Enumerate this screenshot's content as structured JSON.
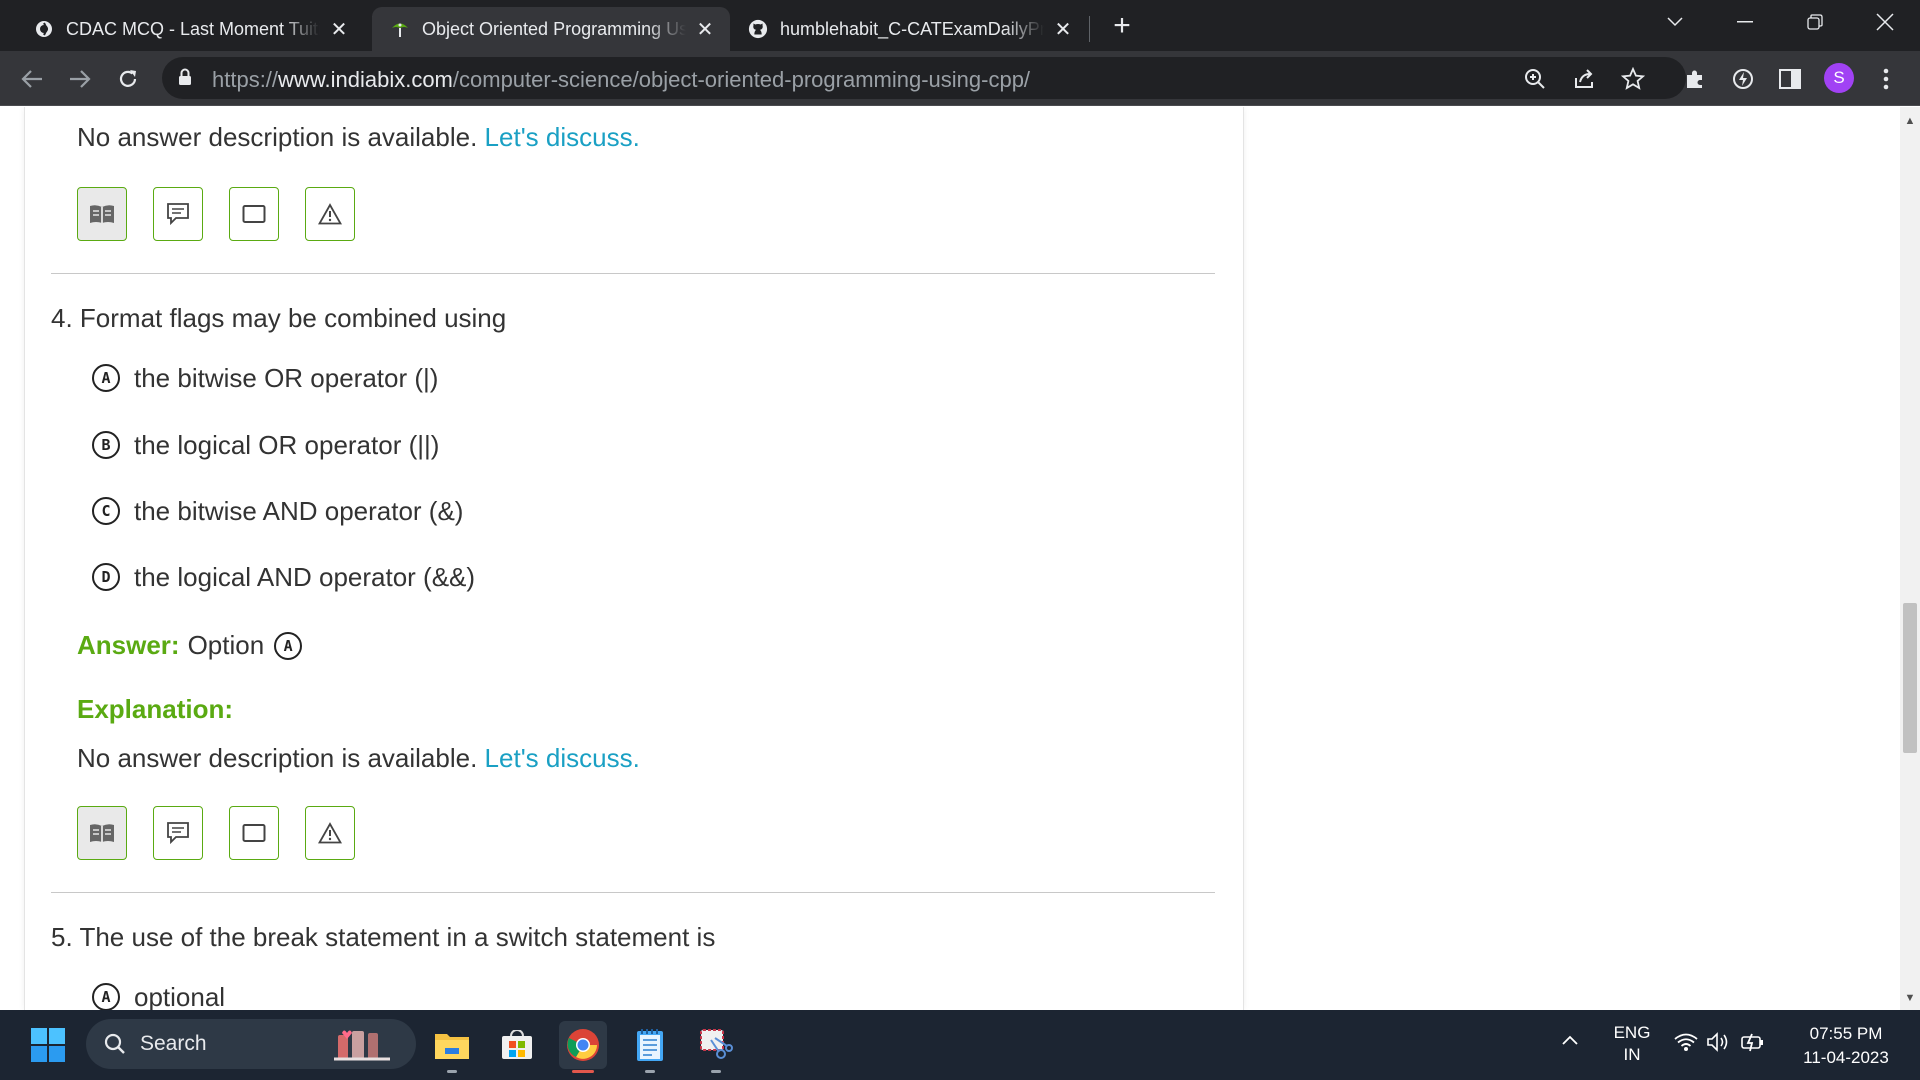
{
  "browser": {
    "tabs": [
      {
        "title": "CDAC MCQ - Last Moment Tuitio",
        "favicon": "cdac-favicon-icon",
        "active": false
      },
      {
        "title": "Object Oriented Programming Us",
        "favicon": "indiabix-favicon-icon",
        "active": true
      },
      {
        "title": "humblehabit_C-CATExamDailyPra",
        "favicon": "github-favicon-icon",
        "active": false
      }
    ],
    "url": {
      "scheme": "https://",
      "host": "www.indiabix.com",
      "path": "/computer-science/object-oriented-programming-using-cpp/"
    },
    "profile_initial": "S"
  },
  "page": {
    "q3_tail": {
      "description": "No answer description is available.",
      "discuss_link": "Let's discuss."
    },
    "question4": {
      "number": "4.",
      "text": "Format flags may be combined using",
      "options": [
        {
          "letter": "A",
          "text": "the bitwise OR operator (|)"
        },
        {
          "letter": "B",
          "text": "the logical OR operator (||)"
        },
        {
          "letter": "C",
          "text": "the bitwise AND operator (&)"
        },
        {
          "letter": "D",
          "text": "the logical AND operator (&&)"
        }
      ],
      "answer_label": "Answer:",
      "answer_prefix": "Option",
      "answer_letter": "A",
      "explanation_label": "Explanation:",
      "description": "No answer description is available.",
      "discuss_link": "Let's discuss."
    },
    "question5": {
      "number": "5.",
      "text": "The use of the break statement in a switch statement is",
      "options": [
        {
          "letter": "A",
          "text": "optional"
        }
      ]
    }
  },
  "taskbar": {
    "search_label": "Search",
    "language_top": "ENG",
    "language_bottom": "IN",
    "time": "07:55 PM",
    "date": "11-04-2023"
  },
  "colors": {
    "accent_green": "#5aaa12",
    "link_blue": "#1aa0c4",
    "profile_purple": "#a142f4"
  }
}
